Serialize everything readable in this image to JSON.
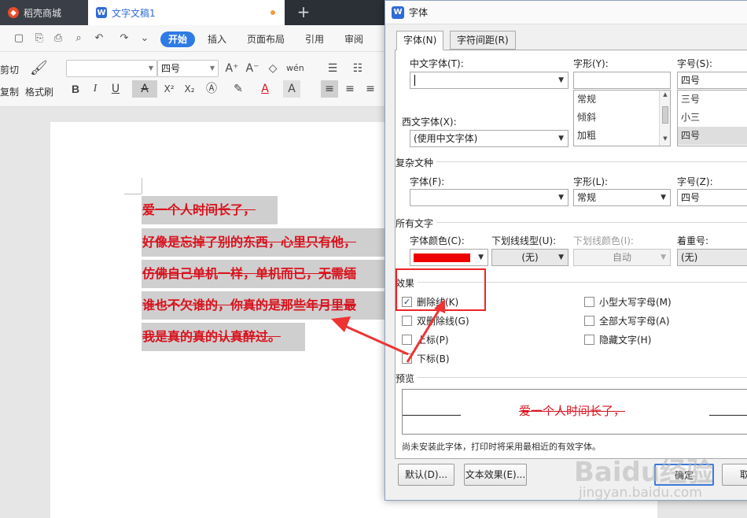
{
  "tabs": {
    "daoke": "稻壳商城",
    "document": "文字文稿1",
    "new_tab": "+"
  },
  "menu": {
    "start": "开始",
    "insert": "插入",
    "layout": "页面布局",
    "references": "引用",
    "review": "审阅"
  },
  "toolbar": {
    "cut": "剪切",
    "copy": "复制",
    "format_painter": "格式刷",
    "font_name": "",
    "font_size": "四号",
    "bold": "B",
    "italic": "I",
    "underline": "U",
    "superscript": "X²",
    "subscript": "X₂",
    "font_color": "A",
    "char_shade": "A",
    "pinyin": "wén"
  },
  "document": {
    "lines": [
      "爱一个人时间长了，",
      "好像是忘掉了别的东西，心里只有他，",
      "仿佛自己单机一样，单机而已，无需缅",
      "谁也不欠谁的，你真的是那些年月里最",
      "我是真的真的认真醉过。"
    ],
    "text_color": "#d9131e",
    "highlight_color": "#cfcfcf"
  },
  "dialog": {
    "title": "字体",
    "tabs": [
      "字体(N)",
      "字符间距(R)"
    ],
    "cn_font_label": "中文字体(T):",
    "cn_font_value": "",
    "style_label": "字形(Y):",
    "style_value": "",
    "style_options": [
      "常规",
      "倾斜",
      "加粗"
    ],
    "size_label": "字号(S):",
    "size_value": "四号",
    "size_options": [
      "三号",
      "小三",
      "四号"
    ],
    "western_font_label": "西文字体(X):",
    "western_font_value": "(使用中文字体)",
    "complex_group": "复杂文种",
    "complex_font_label": "字体(F):",
    "complex_font_value": "",
    "complex_style_label": "字形(L):",
    "complex_style_value": "常规",
    "complex_size_label": "字号(Z):",
    "complex_size_value": "四号",
    "all_text_group": "所有文字",
    "font_color_label": "字体颜色(C):",
    "font_color_value": "#ee0000",
    "underline_type_label": "下划线线型(U):",
    "underline_type_value": "(无)",
    "underline_color_label": "下划线颜色(I):",
    "underline_color_value": "自动",
    "emphasis_label": "着重号:",
    "emphasis_value": "(无)",
    "effects_group": "效果",
    "effects": [
      {
        "label": "删除线(K)",
        "checked": true
      },
      {
        "label": "双删除线(G)",
        "checked": false
      },
      {
        "label": "上标(P)",
        "checked": false
      },
      {
        "label": "下标(B)",
        "checked": false
      }
    ],
    "effects_right": [
      {
        "label": "小型大写字母(M)",
        "checked": false
      },
      {
        "label": "全部大写字母(A)",
        "checked": false
      },
      {
        "label": "隐藏文字(H)",
        "checked": false
      }
    ],
    "preview_group": "预览",
    "preview_text": "爱一个人时间长了，",
    "hint": "尚未安装此字体，打印时将采用最相近的有效字体。",
    "buttons": {
      "default": "默认(D)...",
      "text_effect": "文本效果(E)...",
      "ok": "确定",
      "cancel": "取"
    }
  },
  "watermark": {
    "brand": "Baidu经验",
    "url": "jingyan.baidu.com"
  }
}
